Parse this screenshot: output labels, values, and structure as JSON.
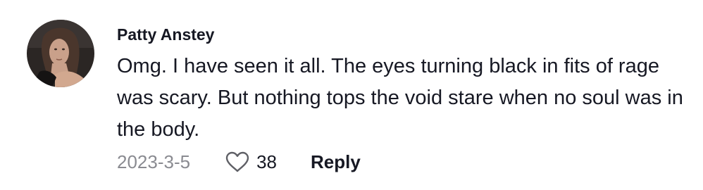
{
  "comment": {
    "username": "Patty Anstey",
    "text": "Omg. I have seen it all. The eyes turning black in fits of rage was scary. But nothing tops the void stare when no soul was in the body.",
    "date": "2023-3-5",
    "like_count": "38",
    "reply_label": "Reply",
    "avatar_icon": "user-avatar-photo",
    "like_icon": "heart-outline-icon"
  },
  "colors": {
    "text_primary": "#161823",
    "text_secondary": "#8a8b91",
    "background": "#ffffff"
  }
}
